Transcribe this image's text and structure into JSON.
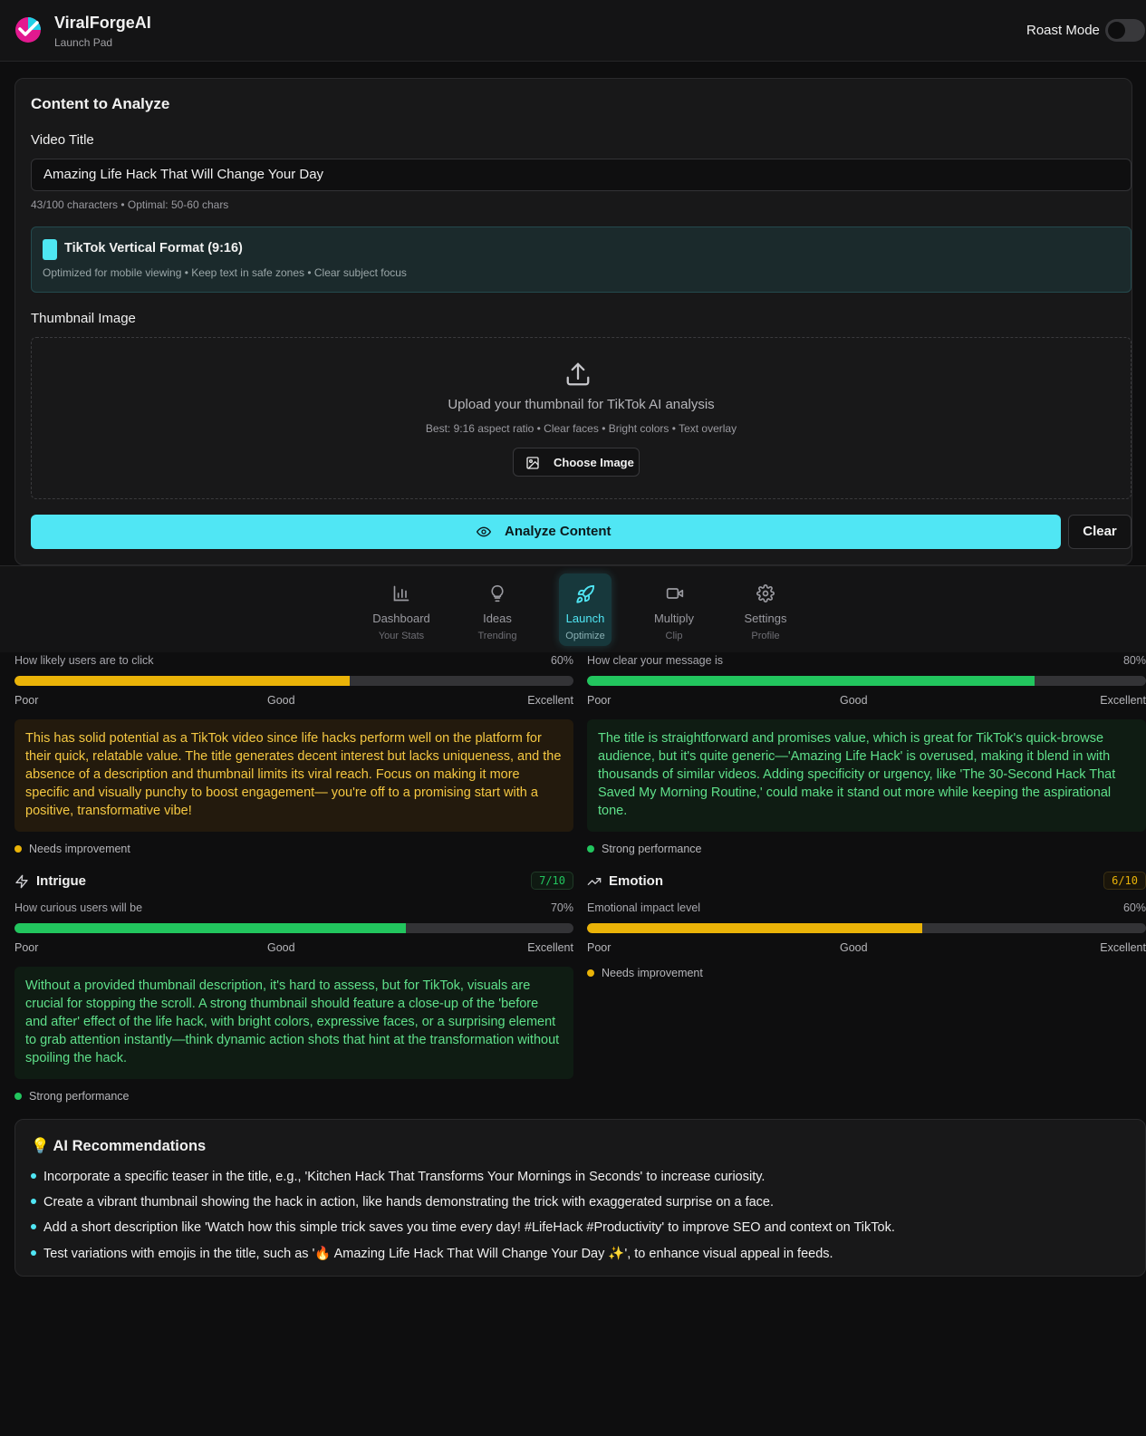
{
  "header": {
    "brand": "ViralForgeAI",
    "subtitle": "Launch Pad",
    "roast_mode_label": "Roast Mode",
    "roast_mode_on": false
  },
  "content": {
    "title": "Content to Analyze",
    "video_title_label": "Video Title",
    "video_title_value": "Amazing Life Hack That Will Change Your Day",
    "char_hint": "43/100 characters • Optimal: 50-60 chars",
    "format": {
      "title": "TikTok Vertical Format (9:16)",
      "subtitle": "Optimized for mobile viewing • Keep text in safe zones • Clear subject focus"
    },
    "thumbnail_label": "Thumbnail Image",
    "upload_title": "Upload your thumbnail for TikTok AI analysis",
    "upload_sub": "Best: 9:16 aspect ratio • Clear faces • Bright colors • Text overlay",
    "choose_button": "Choose Image",
    "analyze_button": "Analyze Content",
    "clear_button": "Clear"
  },
  "nav": [
    {
      "label": "Dashboard",
      "sub": "Your Stats",
      "icon": "bar-chart-icon",
      "active": false
    },
    {
      "label": "Ideas",
      "sub": "Trending",
      "icon": "lightbulb-icon",
      "active": false
    },
    {
      "label": "Launch",
      "sub": "Optimize",
      "icon": "rocket-icon",
      "active": true
    },
    {
      "label": "Multiply",
      "sub": "Clip",
      "icon": "video-icon",
      "active": false
    },
    {
      "label": "Settings",
      "sub": "Profile",
      "icon": "gear-icon",
      "active": false
    }
  ],
  "metrics": {
    "click": {
      "desc": "How likely users are to click",
      "pct": "60%",
      "value": 0.6,
      "feedback": "This has solid potential as a TikTok video since life hacks perform well on the platform for their quick, relatable value. The title generates decent interest but lacks uniqueness, and the absence of a description and thumbnail limits its viral reach. Focus on making it more specific and visually punchy to boost engagement— you're off to a promising start with a positive, transformative vibe!",
      "status": "Needs improvement"
    },
    "clarity": {
      "desc": "How clear your message is",
      "pct": "80%",
      "value": 0.8,
      "feedback": "The title is straightforward and promises value, which is great for TikTok's quick-browse audience, but it's quite generic—'Amazing Life Hack' is overused, making it blend in with thousands of similar videos. Adding specificity or urgency, like 'The 30-Second Hack That Saved My Morning Routine,' could make it stand out more while keeping the aspirational tone.",
      "status": "Strong performance"
    },
    "intrigue": {
      "name": "Intrigue",
      "score": "7/10",
      "desc": "How curious users will be",
      "pct": "70%",
      "value": 0.7,
      "feedback": "Without a provided thumbnail description, it's hard to assess, but for TikTok, visuals are crucial for stopping the scroll. A strong thumbnail should feature a close-up of the 'before and after' effect of the life hack, with bright colors, expressive faces, or a surprising element to grab attention instantly—think dynamic action shots that hint at the transformation without spoiling the hack.",
      "status": "Strong performance"
    },
    "emotion": {
      "name": "Emotion",
      "score": "6/10",
      "desc": "Emotional impact level",
      "pct": "60%",
      "value": 0.6,
      "status": "Needs improvement"
    },
    "scale": {
      "poor": "Poor",
      "good": "Good",
      "excellent": "Excellent"
    }
  },
  "colors": {
    "accent": "#50e6f4",
    "good": "#22c55e",
    "warn": "#eab308"
  },
  "recommendations": {
    "title": "💡 AI Recommendations",
    "items": [
      "Incorporate a specific teaser in the title, e.g., 'Kitchen Hack That Transforms Your Mornings in Seconds' to increase curiosity.",
      "Create a vibrant thumbnail showing the hack in action, like hands demonstrating the trick with exaggerated surprise on a face.",
      "Add a short description like 'Watch how this simple trick saves you time every day! #LifeHack #Productivity' to improve SEO and context on TikTok.",
      "Test variations with emojis in the title, such as '🔥 Amazing Life Hack That Will Change Your Day ✨', to enhance visual appeal in feeds."
    ]
  }
}
